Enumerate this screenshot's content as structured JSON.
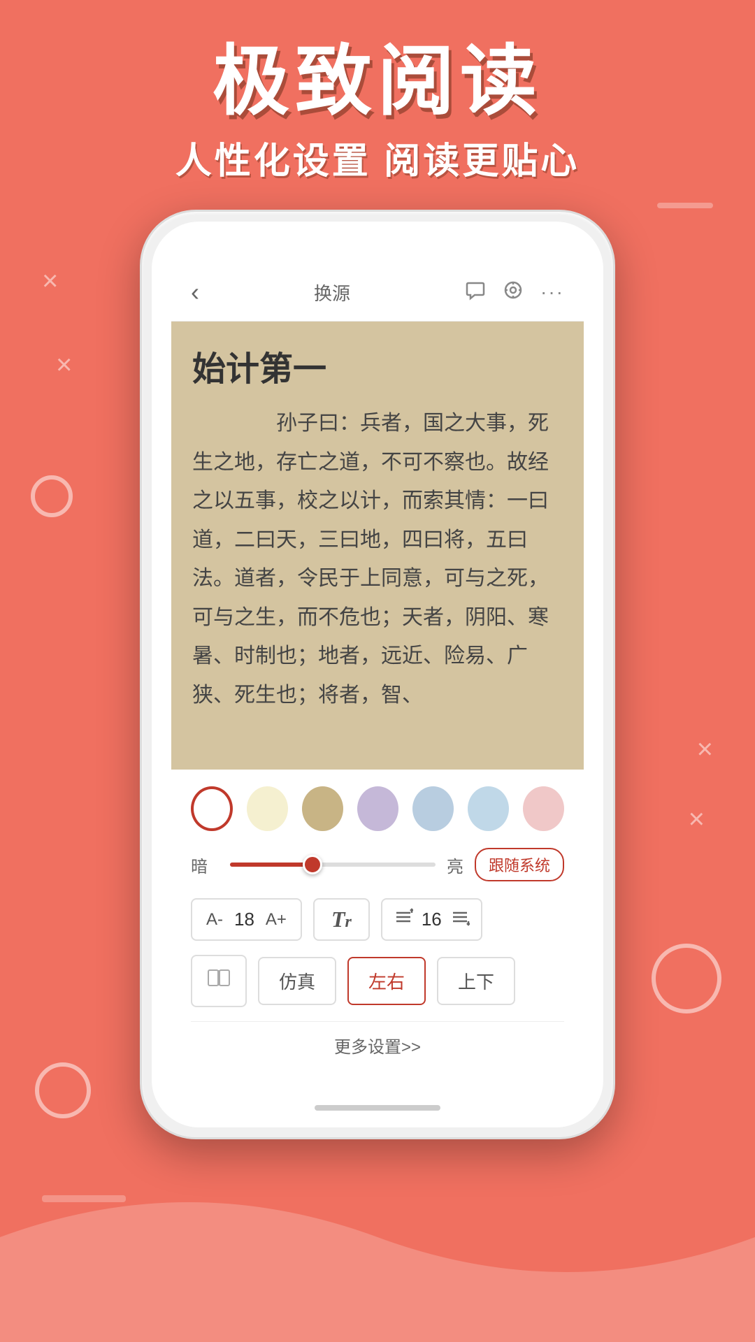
{
  "header": {
    "main_title": "极致阅读",
    "sub_title": "人性化设置  阅读更贴心"
  },
  "phone": {
    "topbar": {
      "back_icon": "‹",
      "title": "换源",
      "chat_icon": "💬",
      "audio_icon": "🎧",
      "more_icon": "···"
    },
    "reading": {
      "chapter_title": "始计第一",
      "content": "　　孙子曰：兵者，国之大事，死生之地，存亡之道，不可不察也。故经之以五事，校之以计，而索其情：一曰道，二曰天，三曰地，四曰将，五曰法。道者，令民于上同意，可与之死，可与之生，而不危也；天者，阴阳、寒暑、时制也；地者，远近、险易、广狭、死生也；将者，智、"
    },
    "settings": {
      "colors": [
        {
          "id": "white",
          "hex": "#ffffff",
          "selected": true
        },
        {
          "id": "cream",
          "hex": "#f5f0d0",
          "selected": false
        },
        {
          "id": "tan",
          "hex": "#c8b485",
          "selected": false
        },
        {
          "id": "lavender",
          "hex": "#c5b8d8",
          "selected": false
        },
        {
          "id": "light_blue",
          "hex": "#b8cde0",
          "selected": false
        },
        {
          "id": "sky",
          "hex": "#c0d8e8",
          "selected": false
        },
        {
          "id": "blush",
          "hex": "#f0c8c8",
          "selected": false
        }
      ],
      "brightness": {
        "dark_label": "暗",
        "light_label": "亮",
        "value": 40,
        "follow_system_label": "跟随系统"
      },
      "font_size": {
        "decrease_label": "A-",
        "value": "18",
        "increase_label": "A+",
        "font_style_label": "Tr",
        "line_spacing_value": "16"
      },
      "page_turn": {
        "book_icon": "📖",
        "options": [
          {
            "label": "仿真",
            "active": false
          },
          {
            "label": "左右",
            "active": true
          },
          {
            "label": "上下",
            "active": false
          }
        ]
      },
      "more_label": "更多设置>>"
    }
  }
}
